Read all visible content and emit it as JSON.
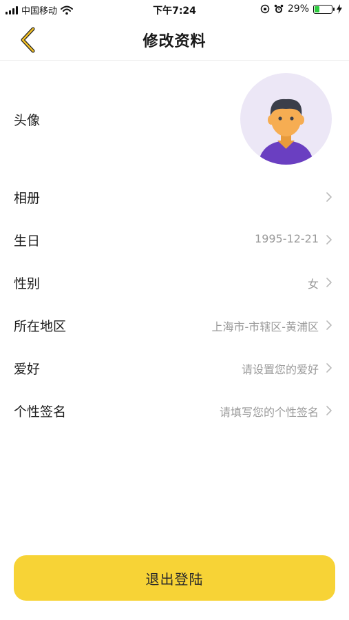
{
  "status_bar": {
    "carrier": "中国移动",
    "time": "下午7:24",
    "battery": "29%",
    "battery_level": 0.29
  },
  "header": {
    "title": "修改资料"
  },
  "profile": {
    "avatar_label": "头像",
    "rows": [
      {
        "label": "相册",
        "value": ""
      },
      {
        "label": "生日",
        "value": "1995-12-21"
      },
      {
        "label": "性别",
        "value": "女"
      },
      {
        "label": "所在地区",
        "value": "上海市-市辖区-黄浦区"
      },
      {
        "label": "爱好",
        "value": "请设置您的爱好"
      },
      {
        "label": "个性签名",
        "value": "请填写您的个性签名"
      }
    ]
  },
  "logout": {
    "label": "退出登陆"
  },
  "colors": {
    "accent": "#f7d336",
    "back_arrow": "#e8b41a",
    "avatar_bg": "#ece7f6",
    "shirt": "#6a3fc1",
    "skin": "#f6ad52"
  }
}
